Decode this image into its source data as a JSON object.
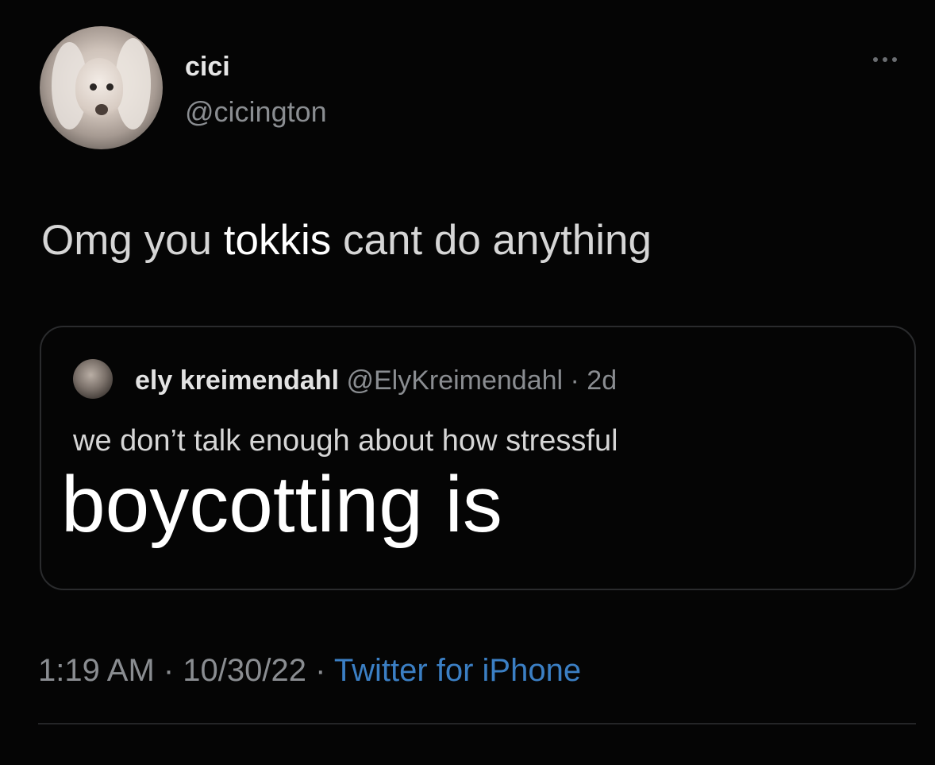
{
  "author": {
    "display_name": "cici",
    "handle": "@cicington"
  },
  "tweet": {
    "text_before": "Omg you ",
    "text_overlay": "tokkis",
    "text_after": " cant do anything"
  },
  "quoted_tweet": {
    "name": "ely kreimendahl",
    "handle_time": " @ElyKreimendahl · 2d",
    "text": "we don’t talk enough about how stressful",
    "overlay_text": "boycotting is"
  },
  "meta": {
    "time_date": "1:19 AM · 10/30/22 · ",
    "source": "Twitter for iPhone"
  },
  "colors": {
    "background": "#050505",
    "link": "#3b7fc4",
    "secondary_text": "#8a8d91"
  },
  "icons": {
    "more": "more-options-icon"
  }
}
